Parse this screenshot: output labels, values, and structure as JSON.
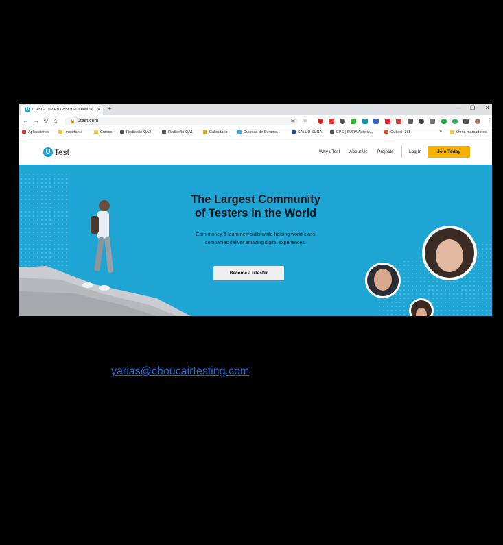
{
  "browser": {
    "tab_title": "uTest - The Professional Network",
    "tab_favicon": "U",
    "new_tab": "+",
    "url": "utest.com",
    "bookmarks": [
      {
        "label": "Aplicaciones",
        "color": "#d33"
      },
      {
        "label": "Importante",
        "color": "#f5c542"
      },
      {
        "label": "Cursos",
        "color": "#f5c542"
      },
      {
        "label": "Rediseño-QA2",
        "color": "#555"
      },
      {
        "label": "Rediseño-QA1",
        "color": "#555"
      },
      {
        "label": "Calendario",
        "color": "#e4a11b"
      },
      {
        "label": "Cuentas de Surame...",
        "color": "#39a7e0"
      },
      {
        "label": "SALUD SURA",
        "color": "#1b4f9c"
      },
      {
        "label": "EPS | SURA Autoriz...",
        "color": "#555"
      },
      {
        "label": "Outlook 365",
        "color": "#e84c1b"
      },
      {
        "label": "Otros marcadores",
        "color": "#f5c542"
      }
    ],
    "more_bookmarks": "»"
  },
  "site": {
    "logo_letter": "U",
    "logo_text": "Test",
    "nav": [
      "Why uTest",
      "About Us",
      "Projects"
    ],
    "login": "Log In",
    "join": "Join Today",
    "accent": "#f7b200"
  },
  "hero": {
    "title_line1": "The Largest Community",
    "title_line2": "of Testers in the World",
    "subtitle_line1": "Earn money & learn new skills while helping world-class",
    "subtitle_line2": "companies deliver amazing digital experiences.",
    "cta": "Become a uTester",
    "background": "#1ea5d3"
  },
  "footer": {
    "email": "yarias@choucairtesting.com"
  }
}
